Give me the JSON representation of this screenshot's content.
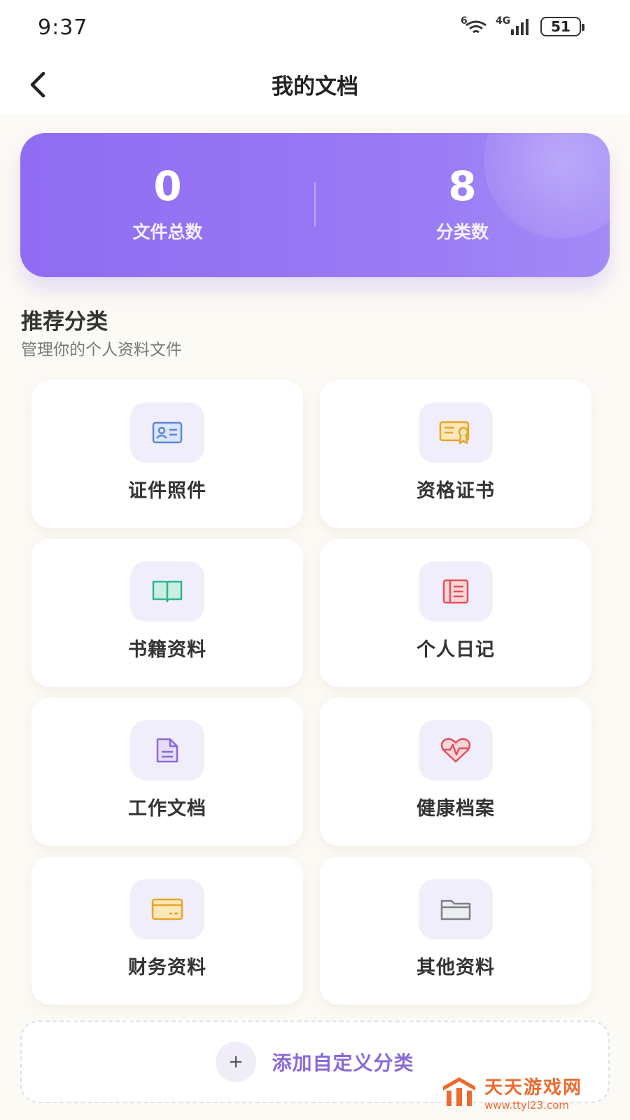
{
  "status_bar": {
    "time": "9:37",
    "signal_label": "6",
    "network": "4G",
    "battery": "51"
  },
  "header": {
    "title": "我的文档"
  },
  "stats": {
    "total_files": {
      "value": "0",
      "label": "文件总数"
    },
    "categories": {
      "value": "8",
      "label": "分类数"
    }
  },
  "section": {
    "title": "推荐分类",
    "subtitle": "管理你的个人资料文件"
  },
  "categories": [
    {
      "label": "证件照件",
      "icon": "id-card-icon",
      "color": "#5b86d6"
    },
    {
      "label": "资格证书",
      "icon": "certificate-icon",
      "color": "#e6a52c"
    },
    {
      "label": "书籍资料",
      "icon": "book-icon",
      "color": "#33b48c"
    },
    {
      "label": "个人日记",
      "icon": "diary-icon",
      "color": "#e0505c"
    },
    {
      "label": "工作文档",
      "icon": "document-icon",
      "color": "#8a6ad8"
    },
    {
      "label": "健康档案",
      "icon": "heart-pulse-icon",
      "color": "#e0505c"
    },
    {
      "label": "财务资料",
      "icon": "wallet-card-icon",
      "color": "#e6a52c"
    },
    {
      "label": "其他资料",
      "icon": "folder-icon",
      "color": "#7b7f88"
    }
  ],
  "add_custom": {
    "label": "添加自定义分类",
    "icon": "plus-icon"
  },
  "watermark": {
    "name": "天天游戏网",
    "url": "www.ttyl23.com"
  },
  "colors": {
    "accent": "#8f6cf2",
    "add_text": "#8a6ad8",
    "watermark": "#ec6a2d"
  }
}
